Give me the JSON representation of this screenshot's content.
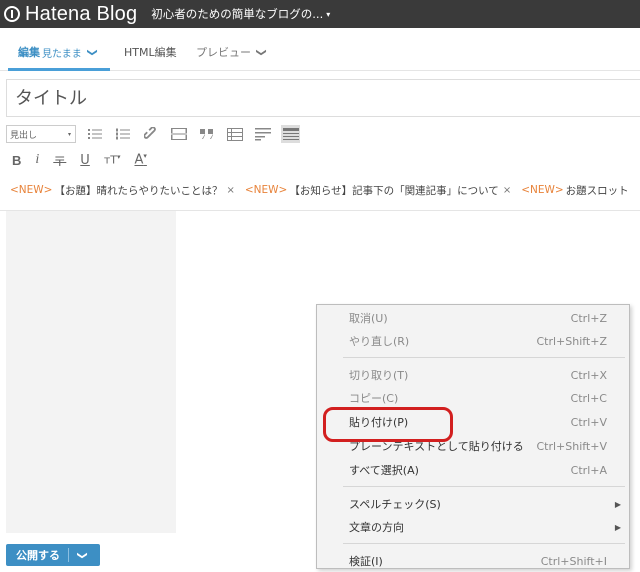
{
  "header": {
    "logo_text": "Hatena Blog",
    "blog_title": "初心者のための簡単なブログの...",
    "blog_title_caret": "▾"
  },
  "tabs": {
    "edit_label": "編集",
    "edit_mode": "見たまま",
    "html_label": "HTML編集",
    "preview_label": "プレビュー",
    "chevron": "❯"
  },
  "title_input": {
    "placeholder": "タイトル",
    "value": ""
  },
  "toolbar": {
    "heading_select": "見出し",
    "format_labels": {
      "bold": "B",
      "italic": "i",
      "strike": "〒",
      "underline": "U",
      "size": "тT",
      "color": "A"
    },
    "icons": [
      "unordered-list-icon",
      "ordered-list-icon",
      "link-icon",
      "more-icon",
      "quote-icon",
      "table-icon",
      "snippet-icon",
      "toggle-icon"
    ]
  },
  "topics": [
    {
      "tag": "<NEW>",
      "text": "【お題】晴れたらやりたいことは？",
      "close": "×"
    },
    {
      "tag": "<NEW>",
      "text": "【お知らせ】記事下の「関連記事」について",
      "close": "×"
    },
    {
      "tag": "<NEW>",
      "text": "お題スロット",
      "close": ""
    }
  ],
  "publish": {
    "label": "公開する",
    "chevron": "❯"
  },
  "context_menu": {
    "items": [
      {
        "label": "取消(U)",
        "shortcut": "Ctrl+Z",
        "disabled": true
      },
      {
        "label": "やり直し(R)",
        "shortcut": "Ctrl+Shift+Z",
        "disabled": true
      },
      {
        "label": "切り取り(T)",
        "shortcut": "Ctrl+X",
        "disabled": true
      },
      {
        "label": "コピー(C)",
        "shortcut": "Ctrl+C",
        "disabled": true
      },
      {
        "label": "貼り付け(P)",
        "shortcut": "Ctrl+V",
        "disabled": false
      },
      {
        "label": "プレーンテキストとして貼り付ける",
        "shortcut": "Ctrl+Shift+V",
        "disabled": false
      },
      {
        "label": "すべて選択(A)",
        "shortcut": "Ctrl+A",
        "disabled": false
      },
      {
        "label": "スペルチェック(S)",
        "shortcut": "",
        "submenu_arrow": "▶",
        "disabled": false
      },
      {
        "label": "文章の方向",
        "shortcut": "",
        "submenu_arrow": "▶",
        "disabled": false
      },
      {
        "label": "検証(I)",
        "shortcut": "Ctrl+Shift+I",
        "disabled": false
      }
    ]
  },
  "colors": {
    "topbar": "#3a3a3a",
    "accent": "#3d8fc4",
    "new_tag": "#e8833a",
    "highlight": "#d21f1f"
  }
}
